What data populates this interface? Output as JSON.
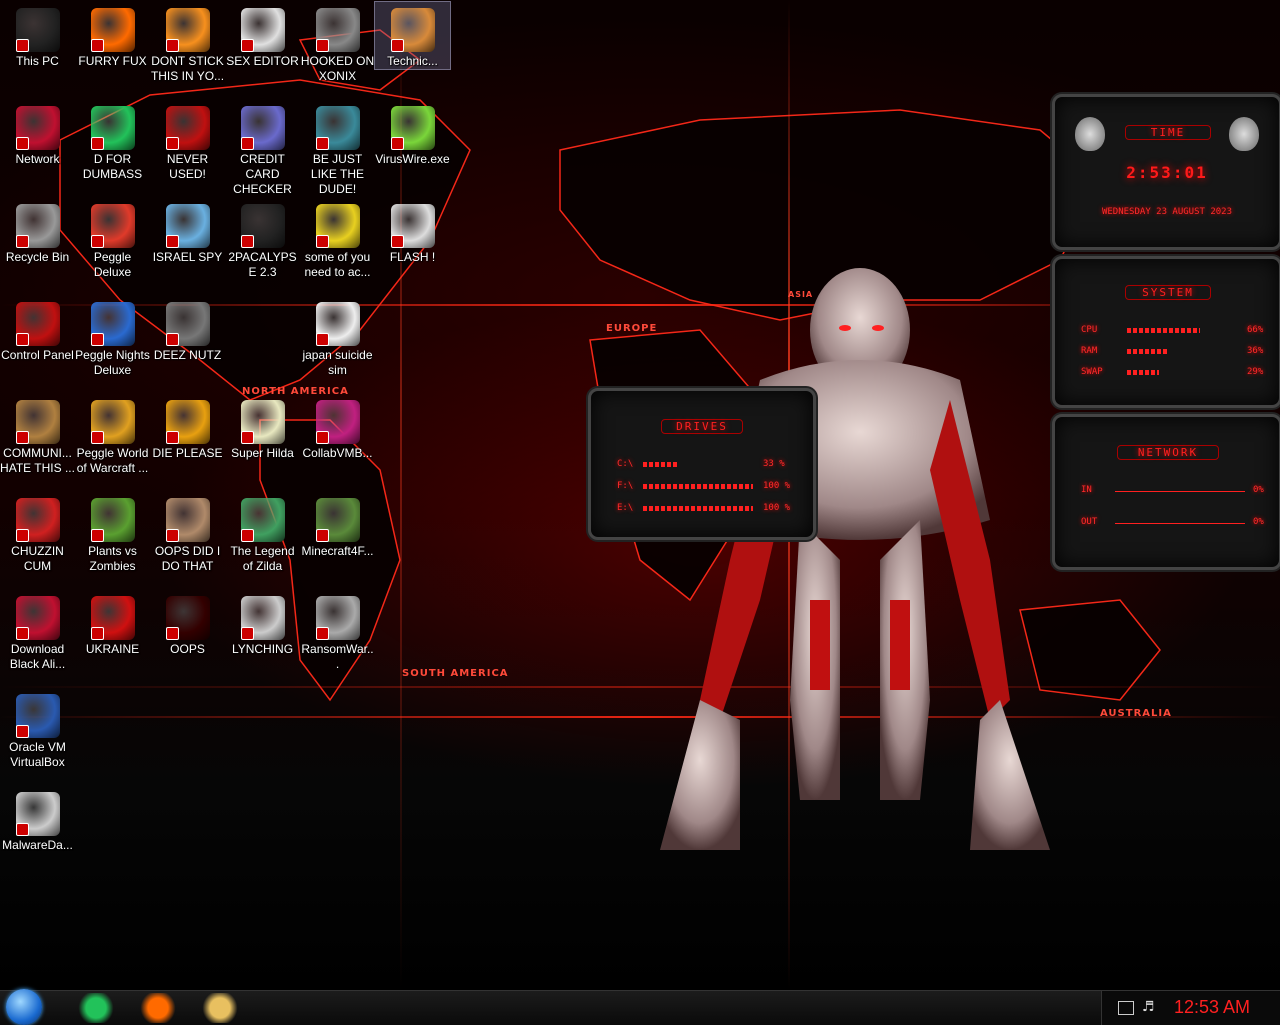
{
  "desktop_icons": [
    {
      "label": "This PC",
      "icon": "this-pc-icon",
      "color": "#222"
    },
    {
      "label": "FURRY FUX",
      "icon": "firefox-icon",
      "color": "#ff6a00"
    },
    {
      "label": "DONT STICK THIS IN YO...",
      "icon": "vlc-cone-icon",
      "color": "#f7901e"
    },
    {
      "label": "SEX EDITOR",
      "icon": "hxd-icon",
      "color": "#e0e0e0"
    },
    {
      "label": "HOOKED ON XONIX",
      "icon": "xonix-icon",
      "color": "#888"
    },
    {
      "label": "Technic...",
      "icon": "technic-user-icon",
      "color": "#d88a3a"
    },
    {
      "label": "Network",
      "icon": "alien-network-icon",
      "color": "#c01030"
    },
    {
      "label": "D FOR DUMBASS",
      "icon": "discord-like-icon",
      "color": "#22c25a"
    },
    {
      "label": "NEVER USED!",
      "icon": "dev-cpp-icon",
      "color": "#c01010"
    },
    {
      "label": "CREDIT CARD CHECKER",
      "icon": "credit-card-icon",
      "color": "#6a6acc"
    },
    {
      "label": "BE JUST LIKE THE DUDE!",
      "icon": "dude-icon",
      "color": "#3a8a9a"
    },
    {
      "label": "VirusWire.exe",
      "icon": "limewire-icon",
      "color": "#7ad63a"
    },
    {
      "label": "Recycle Bin",
      "icon": "recycle-bin-icon",
      "color": "#999"
    },
    {
      "label": "Peggle Deluxe",
      "icon": "peggle-icon",
      "color": "#e03a2a"
    },
    {
      "label": "ISRAEL SPY",
      "icon": "spy-network-icon",
      "color": "#6ab0e0"
    },
    {
      "label": "2PACALYPSE 2.3",
      "icon": "terminal-icon",
      "color": "#222"
    },
    {
      "label": "some of you need to ac...",
      "icon": "cartoon-dog-icon",
      "color": "#e8d020"
    },
    {
      "label": "FLASH !",
      "icon": "flash-icon",
      "color": "#ddd"
    },
    {
      "label": "Control Panel",
      "icon": "control-panel-icon",
      "color": "#c01010"
    },
    {
      "label": "Peggle Nights Deluxe",
      "icon": "peggle-nights-icon",
      "color": "#2a6ad0"
    },
    {
      "label": "DEEZ NUTZ",
      "icon": "window-stack-icon",
      "color": "#777"
    },
    {
      "label": "japan suicide sim",
      "icon": "document-icon",
      "color": "#eee"
    },
    {
      "label": "COMMUNI... HATE THIS ...",
      "icon": "money-bag-icon",
      "color": "#b08040"
    },
    {
      "label": "Peggle World of Warcraft ...",
      "icon": "peggle-wow-icon",
      "color": "#e0a020"
    },
    {
      "label": "DIE PLEASE",
      "icon": "de-icon",
      "color": "#e8a010"
    },
    {
      "label": "Super Hilda",
      "icon": "pixel-cat-icon",
      "color": "#e8e8c0"
    },
    {
      "label": "CollabVMB...",
      "icon": "monitor-icon",
      "color": "#c02080"
    },
    {
      "label": "CHUZZIN CUM",
      "icon": "chuzzle-icon",
      "color": "#d02020"
    },
    {
      "label": "Plants vs Zombies",
      "icon": "pvz-icon",
      "color": "#5aa030"
    },
    {
      "label": "OOPS DID I DO THAT",
      "icon": "portrait-icon",
      "color": "#b08a6a"
    },
    {
      "label": "The Legend of Zilda",
      "icon": "pixel-hero-icon",
      "color": "#40a060"
    },
    {
      "label": "Minecraft4F...",
      "icon": "minecraft-block-icon",
      "color": "#5a8a3a"
    },
    {
      "label": "Download Black Ali...",
      "icon": "alien-download-icon",
      "color": "#c01030"
    },
    {
      "label": "UKRAINE",
      "icon": "radiation-icon",
      "color": "#d01010"
    },
    {
      "label": "OOPS",
      "icon": "oops-icon",
      "color": "#300"
    },
    {
      "label": "LYNCHING",
      "icon": "flower-emblem-icon",
      "color": "#ccc"
    },
    {
      "label": "RansomWar...",
      "icon": "skull-icon",
      "color": "#aaa"
    },
    {
      "label": "Oracle VM VirtualBox",
      "icon": "virtualbox-icon",
      "color": "#2a5ab0"
    },
    {
      "label": "MalwareDa...",
      "icon": "malware-doc-icon",
      "color": "#ccc"
    }
  ],
  "map_labels": [
    "EUROPE",
    "NORTH AMERICA",
    "SOUTH AMERICA",
    "AUSTRALIA",
    "ASIA"
  ],
  "gadgets": {
    "time": {
      "title": "TIME",
      "clock": "2:53:01",
      "date": "WEDNESDAY 23 AUGUST 2023"
    },
    "system": {
      "title": "SYSTEM",
      "rows": [
        {
          "label": "CPU",
          "value": "66%",
          "fill": 0.66
        },
        {
          "label": "RAM",
          "value": "36%",
          "fill": 0.36
        },
        {
          "label": "SWAP",
          "value": "29%",
          "fill": 0.29
        }
      ]
    },
    "drives": {
      "title": "DRIVES",
      "rows": [
        {
          "label": "C:\\",
          "value": "33 %",
          "fill": 0.33
        },
        {
          "label": "F:\\",
          "value": "100 %",
          "fill": 1.0
        },
        {
          "label": "E:\\",
          "value": "100 %",
          "fill": 1.0
        }
      ]
    },
    "network": {
      "title": "NETWORK",
      "rows": [
        {
          "label": "IN",
          "value": "0%"
        },
        {
          "label": "OUT",
          "value": "0%"
        }
      ]
    }
  },
  "taskbar": {
    "start": "start-orb",
    "pinned": [
      {
        "name": "chat-app-icon",
        "color": "#22c25a"
      },
      {
        "name": "firefox-icon",
        "color": "#ff6a00"
      },
      {
        "name": "file-explorer-icon",
        "color": "#e8c060"
      }
    ],
    "clock": "12:53 AM",
    "clock_color": "#ff2020"
  }
}
